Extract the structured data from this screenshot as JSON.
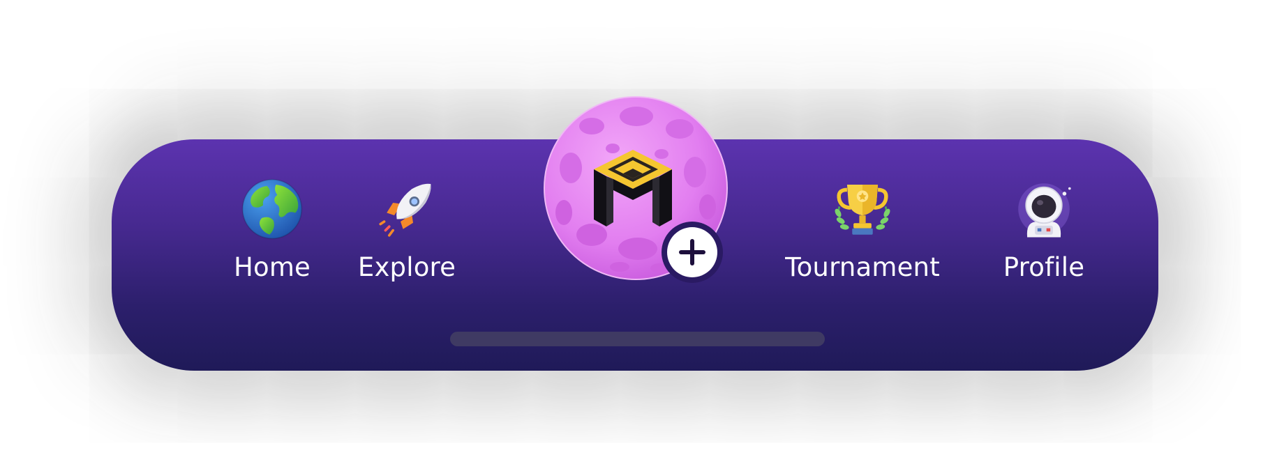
{
  "nav": {
    "items": [
      {
        "id": "home",
        "label": "Home",
        "icon": "earth-globe-icon"
      },
      {
        "id": "explore",
        "label": "Explore",
        "icon": "rocket-icon"
      },
      {
        "id": "tournament",
        "label": "Tournament",
        "icon": "trophy-icon"
      },
      {
        "id": "profile",
        "label": "Profile",
        "icon": "astronaut-icon"
      }
    ],
    "center_action": {
      "icon": "moon-logo-icon",
      "badge_icon": "plus-icon"
    }
  },
  "colors": {
    "bar_top": "#5c33af",
    "bar_bottom": "#1f1a58",
    "label": "#ffffff",
    "moon": "#e27ef0",
    "logo_yellow": "#f5c630",
    "plus_ring": "#2a1a63"
  }
}
